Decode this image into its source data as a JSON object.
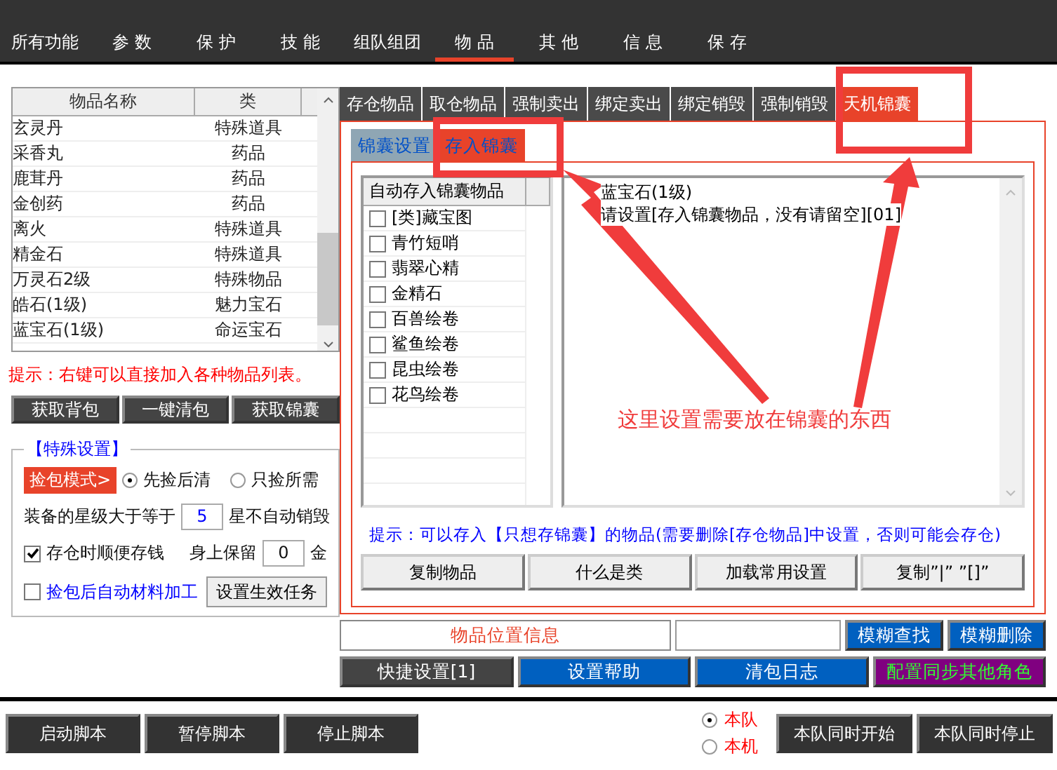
{
  "menu": [
    {
      "label": "所有功能",
      "selected": false
    },
    {
      "label": "参 数",
      "selected": false
    },
    {
      "label": "保 护",
      "selected": false
    },
    {
      "label": "技 能",
      "selected": false
    },
    {
      "label": "组队组团",
      "selected": false
    },
    {
      "label": "物 品",
      "selected": true
    },
    {
      "label": "其 他",
      "selected": false
    },
    {
      "label": "信 息",
      "selected": false
    },
    {
      "label": "保 存",
      "selected": false
    }
  ],
  "item_table": {
    "columns": [
      "物品名称",
      "类"
    ],
    "rows": [
      [
        "玄灵丹",
        "特殊道具"
      ],
      [
        "采香丸",
        "药品"
      ],
      [
        "鹿茸丹",
        "药品"
      ],
      [
        "金创药",
        "药品"
      ],
      [
        "离火",
        "特殊道具"
      ],
      [
        "精金石",
        "特殊道具"
      ],
      [
        "万灵石2级",
        "特殊物品"
      ],
      [
        "皓石(1级)",
        "魅力宝石"
      ],
      [
        "蓝宝石(1级)",
        "命运宝石"
      ]
    ]
  },
  "hint": "提示：右键可以直接加入各种物品列表。",
  "item_buttons": [
    "获取背包",
    "一键清包",
    "获取锦囊"
  ],
  "special_settings": {
    "title": "【特殊设置】",
    "pick_mode_label": "捡包模式>",
    "pick_modes": [
      {
        "label": "先捡后清",
        "selected": true
      },
      {
        "label": "只捡所需",
        "selected": false
      }
    ],
    "star_label": "装备的星级大于等于",
    "star_value": "5",
    "star_suffix": "星不自动销毁",
    "deposit_money": {
      "label": "存仓时顺便存钱",
      "checked": true
    },
    "keep_label": "身上保留",
    "keep_value": "0",
    "keep_suffix": "金",
    "auto_process": {
      "label": "捡包后自动材料加工",
      "checked": false
    },
    "task_button": "设置生效任务"
  },
  "tabs": [
    {
      "label": "存仓物品",
      "selected": false
    },
    {
      "label": "取仓物品",
      "selected": false
    },
    {
      "label": "强制卖出",
      "selected": false
    },
    {
      "label": "绑定卖出",
      "selected": false
    },
    {
      "label": "绑定销毁",
      "selected": false
    },
    {
      "label": "强制销毁",
      "selected": false
    },
    {
      "label": "天机锦囊",
      "selected": true
    }
  ],
  "subtabs": [
    {
      "label": "锦囊设置",
      "selected": false
    },
    {
      "label": "存入锦囊",
      "selected": true
    }
  ],
  "store_list": {
    "column": "自动存入锦囊物品",
    "items": [
      {
        "label": "[类]藏宝图",
        "checked": false
      },
      {
        "label": "青竹短哨",
        "checked": false
      },
      {
        "label": "翡翠心精",
        "checked": false
      },
      {
        "label": "金精石",
        "checked": false
      },
      {
        "label": "百兽绘卷",
        "checked": false
      },
      {
        "label": "鲨鱼绘卷",
        "checked": false
      },
      {
        "label": "昆虫绘卷",
        "checked": false
      },
      {
        "label": "花鸟绘卷",
        "checked": false
      }
    ]
  },
  "log": [
    "蓝宝石(1级)",
    "请设置[存入锦囊物品，没有请留空][01]"
  ],
  "store_hint": "提示：可以存入【只想存锦囊】的物品(需要删除[存仓物品]中设置，否则可能会存仓)",
  "store_buttons": [
    "复制物品",
    "什么是类",
    "加载常用设置",
    "复制”|” ”[]”"
  ],
  "location_info": "物品位置信息",
  "search_buttons": [
    "模糊查找",
    "模糊删除"
  ],
  "action_buttons": [
    {
      "label": "快捷设置[1]",
      "kind": "dark"
    },
    {
      "label": "设置帮助",
      "kind": "blue"
    },
    {
      "label": "清包日志",
      "kind": "blue"
    },
    {
      "label": "配置同步其他角色",
      "kind": "purple"
    }
  ],
  "script_buttons": [
    "启动脚本",
    "暂停脚本",
    "停止脚本"
  ],
  "scope": [
    {
      "label": "本队",
      "selected": true
    },
    {
      "label": "本机",
      "selected": false
    }
  ],
  "team_buttons": [
    "本队同时开始",
    "本队同时停止"
  ],
  "annotation": {
    "text": "这里设置需要放在锦囊的东西"
  }
}
